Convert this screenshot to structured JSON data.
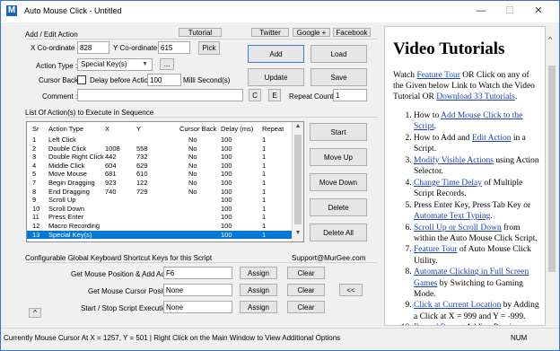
{
  "window": {
    "title": "Auto Mouse Click - Untitled",
    "app_icon": "M",
    "minimize": "—",
    "maximize": "☐",
    "close": "✕"
  },
  "header_links": {
    "tutorial": "Tutorial",
    "twitter": "Twitter",
    "google": "Google +",
    "facebook": "Facebook"
  },
  "add_edit": {
    "group_label": "Add / Edit Action",
    "x_label": "X Co-ordinate :",
    "x_value": "828",
    "y_label": "Y Co-ordinate :",
    "y_value": "615",
    "pick": "Pick",
    "action_type_label": "Action Type :",
    "action_type_value": "Special Key(s)",
    "more": "...",
    "cursor_back_label": "Cursor Back :",
    "delay_before_label": "Delay before Action :",
    "delay_before_value": "100",
    "delay_unit": "Milli Second(s)",
    "comment_label": "Comment :",
    "comment_value": "",
    "c_btn": "C",
    "e_btn": "E",
    "repeat_label": "Repeat Count :",
    "repeat_value": "1",
    "add": "Add",
    "load": "Load",
    "update": "Update",
    "save": "Save"
  },
  "list": {
    "group_label": "List Of Action(s) to Execute in Sequence",
    "columns": [
      "Sr",
      "Action Type",
      "X",
      "Y",
      "Cursor Back",
      "Delay (ms)",
      "Repeat"
    ],
    "rows": [
      [
        "1",
        "Left Click",
        "",
        "",
        "No",
        "100",
        "1"
      ],
      [
        "2",
        "Double Click",
        "1008",
        "558",
        "No",
        "100",
        "1"
      ],
      [
        "3",
        "Double Right Click",
        "442",
        "732",
        "No",
        "100",
        "1"
      ],
      [
        "4",
        "Middle Click",
        "604",
        "629",
        "No",
        "100",
        "1"
      ],
      [
        "5",
        "Move Mouse",
        "681",
        "610",
        "No",
        "100",
        "1"
      ],
      [
        "7",
        "Begin Dragging",
        "923",
        "122",
        "No",
        "100",
        "1"
      ],
      [
        "8",
        "End Dragging",
        "740",
        "729",
        "No",
        "100",
        "1"
      ],
      [
        "9",
        "Scroll Up",
        "",
        "",
        "",
        "100",
        "1"
      ],
      [
        "10",
        "Scroll Down",
        "",
        "",
        "",
        "100",
        "1"
      ],
      [
        "11",
        "Press Enter",
        "",
        "",
        "",
        "100",
        "1"
      ],
      [
        "12",
        "Macro Recording",
        "",
        "",
        "",
        "100",
        "1"
      ],
      [
        "13",
        "Special Key(s)",
        "",
        "",
        "",
        "100",
        "1"
      ]
    ],
    "selected_row": 11,
    "start": "Start",
    "move_up": "Move Up",
    "move_down": "Move Down",
    "delete": "Delete",
    "delete_all": "Delete All"
  },
  "shortcuts": {
    "group_label": "Configurable Global Keyboard Shortcut Keys for this Script",
    "support": "Support@MurGee.com",
    "rows": [
      {
        "label": "Get Mouse Position & Add Action :",
        "value": "F6",
        "assign": "Assign",
        "clear": "Clear"
      },
      {
        "label": "Get Mouse Cursor Position :",
        "value": "None",
        "assign": "Assign",
        "clear": "Clear"
      },
      {
        "label": "Start / Stop Script Execution :",
        "value": "None",
        "assign": "Assign",
        "clear": "Clear"
      }
    ],
    "collapse": "<<",
    "expand": "^"
  },
  "panel": {
    "heading": "Video Tutorials",
    "intro_1": "Watch ",
    "intro_link_1": "Feature Tour",
    "intro_2": " OR Click on any of the Given below Link to Watch the Video Tutorial OR ",
    "intro_link_2": "Download 33 Tutorials",
    "intro_3": ".",
    "items": [
      {
        "pre": "How to ",
        "link": "Add Mouse Click to the Script",
        "post": "."
      },
      {
        "pre": "How to Add and ",
        "link": "Edit Action",
        "post": " in a Script."
      },
      {
        "pre": "",
        "link": "Modify Visible Actions",
        "post": " using Action Selector."
      },
      {
        "pre": "",
        "link": "Change Time Delay",
        "post": " of Multiple Script Records."
      },
      {
        "pre": "Press Enter Key, Press Tab Key or ",
        "link": "Automate Text Typing",
        "post": "."
      },
      {
        "pre": "",
        "link": "Scroll Up or Scroll Down",
        "post": " from within the Auto Mouse Click Script."
      },
      {
        "pre": "",
        "link": "Feature Tour",
        "post": " of Auto Mouse Click Utility."
      },
      {
        "pre": "",
        "link": "Automate Clicking in Full Screen Games",
        "post": " by Switching to Gaming Mode."
      },
      {
        "pre": "",
        "link": "Click at Current Location",
        "post": " by Adding a Click at X = 999 and Y = -999."
      },
      {
        "pre": "",
        "link": "Record Repeat",
        "post": " Adding Previous..."
      }
    ]
  },
  "status": {
    "text": "Currently Mouse Cursor At X = 1257, Y = 501 | Right Click on the Main Window to View Additional Options",
    "num": "NUM"
  }
}
